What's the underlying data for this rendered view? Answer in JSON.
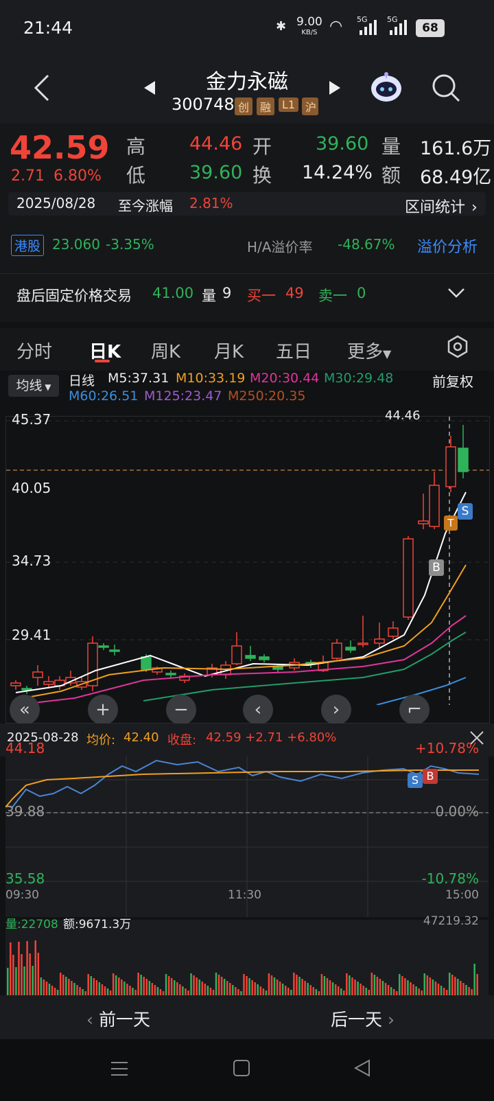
{
  "status_bar": {
    "time": "21:44",
    "speed": "9.00",
    "speed_unit": "KB/S",
    "sig1": "5G",
    "sig2": "5G",
    "battery": "68"
  },
  "header": {
    "name": "金力永磁",
    "code": "300748",
    "tags": [
      "创",
      "融",
      "L1",
      "沪"
    ]
  },
  "quote": {
    "price": "42.59",
    "change": "2.71",
    "change_pct": "6.80%",
    "high_label": "高",
    "high": "44.46",
    "low_label": "低",
    "low": "39.60",
    "open_label": "开",
    "open": "39.60",
    "turnover_label": "换",
    "turnover": "14.24%",
    "volume_label": "量",
    "volume": "161.6万",
    "amount_label": "额",
    "amount": "68.49亿",
    "date": "2025/08/28",
    "since_label": "至今涨幅",
    "since_value": "2.81%",
    "range_stats": "区间统计"
  },
  "hk": {
    "tag": "港股",
    "price": "23.060",
    "change": "-3.35%",
    "premium_label": "H/A溢价率",
    "premium_value": "-48.67%",
    "analysis": "溢价分析"
  },
  "after_hours": {
    "label": "盘后固定价格交易",
    "price": "41.00",
    "vol_label": "量",
    "vol": "9",
    "buy_label": "买一",
    "buy": "49",
    "sell_label": "卖一",
    "sell": "0"
  },
  "tabs": [
    "分时",
    "日K",
    "周K",
    "月K",
    "五日",
    "更多"
  ],
  "ma_legend": {
    "type_btn": "均线",
    "period": "日线",
    "m5": "M5:37.31",
    "m10": "M10:33.19",
    "m20": "M20:30.44",
    "m30": "M30:29.48",
    "m60": "M60:26.51",
    "m125": "M125:23.47",
    "m250": "M250:20.35",
    "adjust": "前复权"
  },
  "kline": {
    "y_labels": [
      "45.37",
      "40.05",
      "34.73",
      "29.41"
    ],
    "high_marker": "44.46",
    "signals": {
      "b": "B",
      "s": "S",
      "t": "T"
    },
    "colors": {
      "up": "#f04438",
      "down": "#2fb35a",
      "m5": "#ffffff",
      "m10": "#f0a020",
      "m20": "#e0359a",
      "m30": "#1f9e6a",
      "m60": "#3a8fe0"
    }
  },
  "intraday": {
    "date": "2025-08-28",
    "avg_label": "均价:",
    "avg": "42.40",
    "close_label": "收盘:",
    "close": "42.59 +2.71 +6.80%",
    "y_top": "44.18",
    "y_mid": "39.88",
    "y_bot": "35.58",
    "pct_top": "+10.78%",
    "pct_mid": "0.00%",
    "pct_bot": "-10.78%",
    "t_start": "09:30",
    "t_mid": "11:30",
    "t_end": "15:00",
    "vol_label": "量:22708",
    "amount_label": "额:9671.3万",
    "vol_max": "47219.32"
  },
  "day_nav": {
    "prev": "前一天",
    "next": "后一天"
  }
}
